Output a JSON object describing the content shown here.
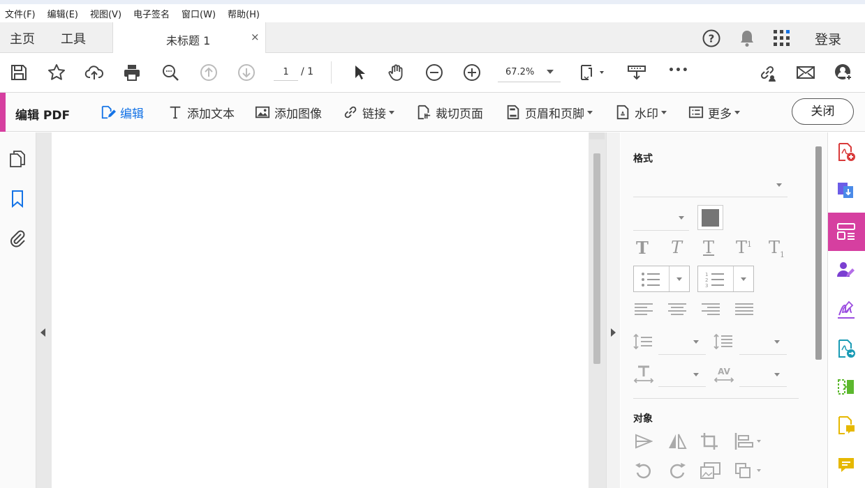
{
  "menu": [
    "文件(F)",
    "编辑(E)",
    "视图(V)",
    "电子签名",
    "窗口(W)",
    "帮助(H)"
  ],
  "tabs": {
    "home": "主页",
    "tools": "工具",
    "document": "未标题 1",
    "close_symbol": "×",
    "login": "登录"
  },
  "toolbar": {
    "page_current": "1",
    "page_total": "/ 1",
    "zoom": "67.2%",
    "more": "•••"
  },
  "editbar": {
    "title": "编辑 PDF",
    "items": [
      "编辑",
      "添加文本",
      "添加图像",
      "链接",
      "裁切页面",
      "页眉和页脚",
      "水印",
      "更多"
    ],
    "close": "关闭",
    "accent": "#d63fa0",
    "edit_active_color": "#1473e6"
  },
  "panel": {
    "format_title": "格式",
    "object_title": "对象"
  },
  "colors": {
    "text_color_swatch": "#757575",
    "rail_selected": "#d63fa0"
  }
}
